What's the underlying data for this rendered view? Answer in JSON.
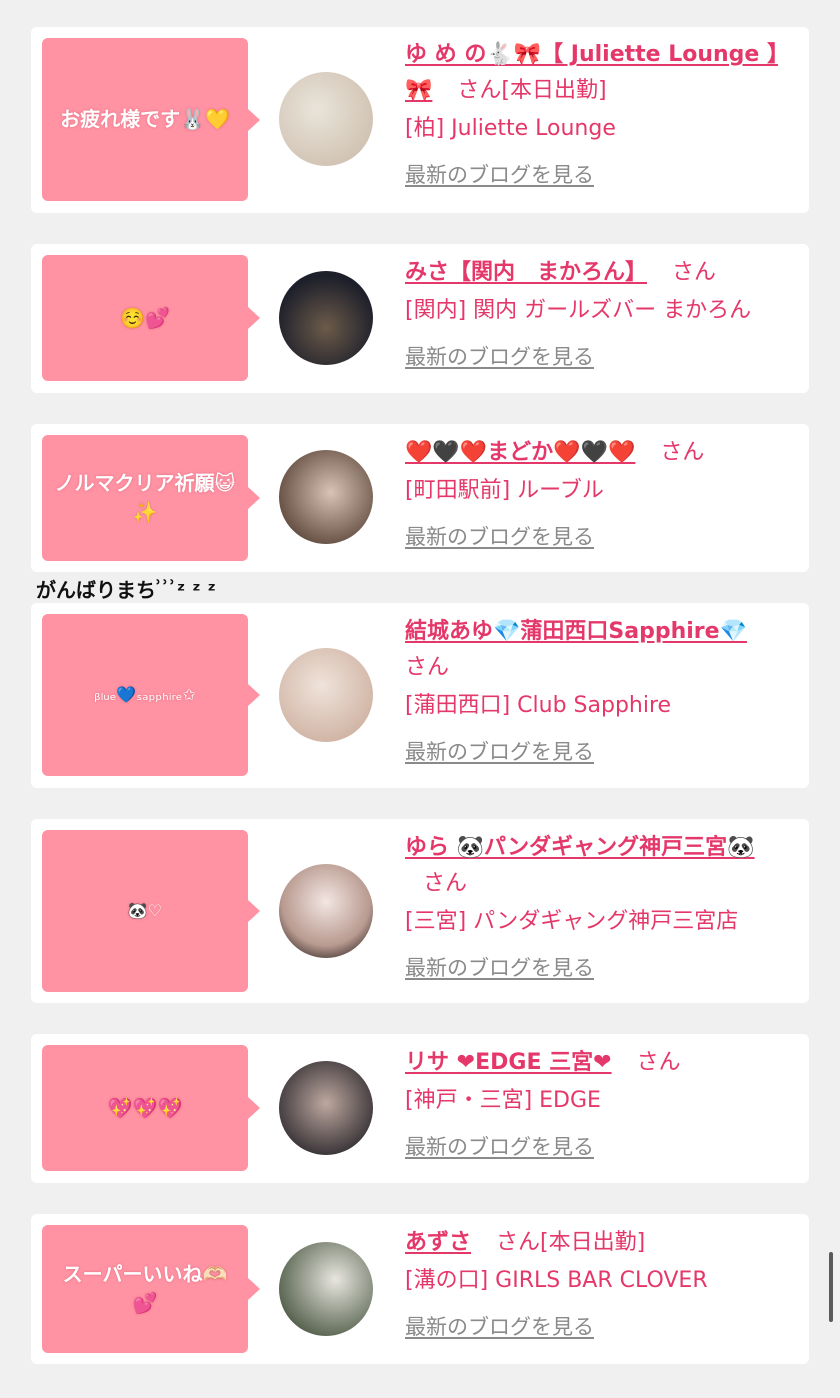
{
  "cards": [
    {
      "bubble": "お疲れ様です🐰💛",
      "name": "ゆ め の🐇🎀【 Juliette Lounge 】🎀",
      "san": "さん",
      "status": "[本日出勤]",
      "shop": "[柏] Juliette Lounge",
      "blog": "最新のブログを見る",
      "avatar_colors": [
        "#e9e4da",
        "#c9b8a6"
      ]
    },
    {
      "bubble": "☺️💕",
      "name": "みさ【関内　まかろん】",
      "san": "さん",
      "status": "",
      "shop": "[関内] 関内 ガールズバー まかろん",
      "blog": "最新のブログを見る",
      "avatar_colors": [
        "#1d1f2a",
        "#6c5b4a"
      ]
    },
    {
      "bubble": "ノルマクリア祈願😺✨",
      "name": "❤️🖤❤️まどか❤️🖤❤️",
      "san": "さん",
      "status": "",
      "shop": "[町田駅前] ルーブル",
      "blog": "最新のブログを見る",
      "avatar_colors": [
        "#d9c3b5",
        "#5b4639"
      ]
    },
    {
      "bubble": "ᵦₗᵤₑ💙ₛₐₚₚₕᵢᵣₑ✩",
      "name": "結城あゆ💎蒲田西口Sapphire💎",
      "san": "さん",
      "status": "",
      "shop": "[蒲田西口] Club Sapphire",
      "blog": "最新のブログを見る",
      "avatar_colors": [
        "#efe3db",
        "#c6a592"
      ]
    },
    {
      "bubble": "🐼♡",
      "name": "ゆら 🐼パンダギャング神戸三宮🐼",
      "san": "さん",
      "status": "",
      "shop": "[三宮] パンダギャング神戸三宮店",
      "blog": "最新のブログを見る",
      "avatar_colors": [
        "#f3e6e2",
        "#2b2220"
      ]
    },
    {
      "bubble": "💖💖💖",
      "name": "リサ ❤EDGE 三宮❤",
      "san": "さん",
      "status": "",
      "shop": "[神戸・三宮] EDGE",
      "blog": "最新のブログを見る",
      "avatar_colors": [
        "#3a3438",
        "#bda89f"
      ]
    },
    {
      "bubble": "スーパーいいね🫶🏻💕",
      "name": "あずさ",
      "san": "さん",
      "status": "[本日出勤]",
      "shop": "[溝の口] GIRLS BAR CLOVER",
      "blog": "最新のブログを見る",
      "avatar_colors": [
        "#e8e6df",
        "#4d5a45"
      ]
    }
  ],
  "caption": "がんばりまち ͗ ͗ ͗ᶻ ᶻ ᶻ",
  "colors": {
    "pink": "#ff92a3",
    "accent": "#e5386a",
    "link_gray": "#8a8a8a",
    "background": "#f0f0f0"
  }
}
